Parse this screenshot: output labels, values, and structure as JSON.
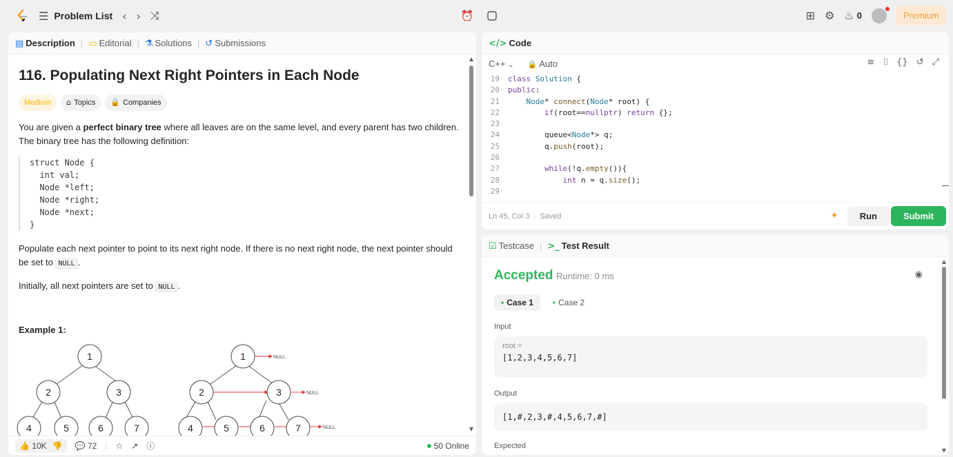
{
  "topbar": {
    "problem_list_label": "Problem List",
    "streak_count": "0",
    "premium_label": "Premium"
  },
  "left_panel": {
    "tabs": {
      "description": "Description",
      "editorial": "Editorial",
      "solutions": "Solutions",
      "submissions": "Submissions"
    },
    "title": "116. Populating Next Right Pointers in Each Node",
    "badges": {
      "difficulty": "Medium",
      "topics": "Topics",
      "companies": "Companies"
    },
    "paragraph1_pre": "You are given a ",
    "paragraph1_bold": "perfect binary tree",
    "paragraph1_post": " where all leaves are on the same level, and every parent has two children. The binary tree has the following definition:",
    "struct_code": "struct Node {\n  int val;\n  Node *left;\n  Node *right;\n  Node *next;\n}",
    "paragraph2_pre": "Populate each next pointer to point to its next right node. If there is no next right node, the next pointer should be set to ",
    "null_token": "NULL",
    "paragraph2_post": ".",
    "paragraph3_pre": "Initially, all next pointers are set to ",
    "paragraph3_post": ".",
    "example_heading": "Example 1:",
    "tree_nodes": [
      "1",
      "2",
      "3",
      "4",
      "5",
      "6",
      "7"
    ],
    "null_label": "NULL",
    "footer": {
      "likes": "10K",
      "comments": "72",
      "online": "50 Online"
    }
  },
  "code_panel": {
    "header": "Code",
    "language": "C++",
    "mode": "Auto",
    "lines": [
      {
        "n": "19",
        "html": "<span class='kw'>class</span> <span class='ty'>Solution</span> {"
      },
      {
        "n": "20",
        "html": "<span class='kw'>public</span>:"
      },
      {
        "n": "21",
        "html": "    <span class='ty'>Node</span>* <span class='fn'>connect</span>(<span class='ty'>Node</span>* root) {"
      },
      {
        "n": "22",
        "html": "        <span class='kw'>if</span>(root==<span class='kw'>nullptr</span>) <span class='kw'>return</span> {};"
      },
      {
        "n": "23",
        "html": ""
      },
      {
        "n": "24",
        "html": "        queue&lt;<span class='ty'>Node</span>*&gt; q;"
      },
      {
        "n": "25",
        "html": "        q.<span class='fn'>push</span>(root);"
      },
      {
        "n": "26",
        "html": ""
      },
      {
        "n": "27",
        "html": "        <span class='kw'>while</span>(!q.<span class='fn'>empty</span>()){"
      },
      {
        "n": "28",
        "html": "            <span class='kw'>int</span> n = q.<span class='fn'>size</span>();"
      },
      {
        "n": "29",
        "html": ""
      }
    ],
    "status": "Ln 45, Col 3",
    "saved": "Saved",
    "run_label": "Run",
    "submit_label": "Submit"
  },
  "result_panel": {
    "tabs": {
      "testcase": "Testcase",
      "test_result": "Test Result"
    },
    "verdict": "Accepted",
    "runtime": "Runtime: 0 ms",
    "cases": [
      "Case 1",
      "Case 2"
    ],
    "input_label": "Input",
    "input_var": "root =",
    "input_value": "[1,2,3,4,5,6,7]",
    "output_label": "Output",
    "output_value": "[1,#,2,3,#,4,5,6,7,#]",
    "expected_label": "Expected"
  },
  "colors": {
    "accent_green": "#2db55d",
    "medium_yellow": "#ffb800",
    "premium_orange": "#e8a23f",
    "pointer_red": "#e03131"
  }
}
